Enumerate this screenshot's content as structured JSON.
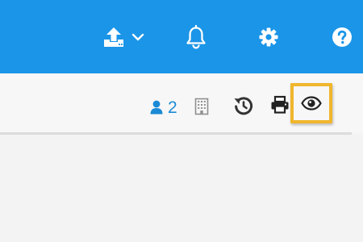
{
  "topbar": {
    "background": "#1b95e8",
    "icons": [
      "upload-icon",
      "chevron-down-icon",
      "bell-icon",
      "gear-icon",
      "help-icon"
    ]
  },
  "toolbar": {
    "members": {
      "icon": "user-icon",
      "count": "2"
    },
    "icons": [
      "building-icon",
      "history-icon",
      "print-icon",
      "eye-icon"
    ],
    "highlighted": "eye-icon",
    "highlight_color": "#f0b62c",
    "accent_color": "#1b8ad6"
  }
}
